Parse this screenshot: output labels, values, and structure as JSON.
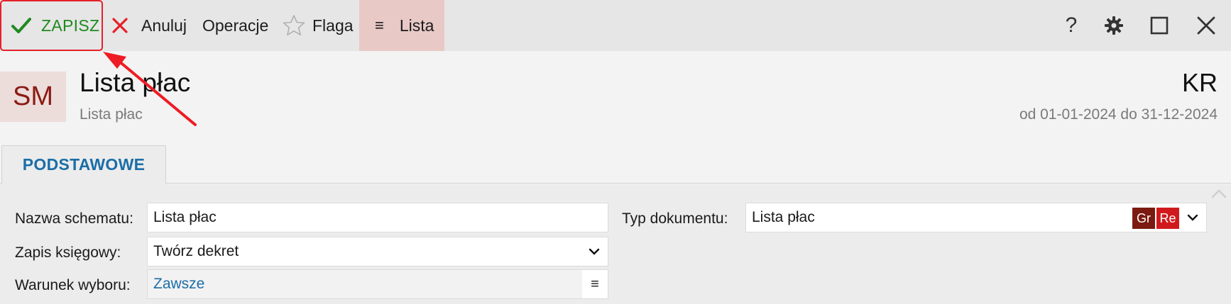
{
  "toolbar": {
    "save_label": "ZAPISZ",
    "cancel_label": "Anuluj",
    "operations_label": "Operacje",
    "flag_label": "Flaga",
    "list_label": "Lista",
    "list_glyph": "≡",
    "help_glyph": "?"
  },
  "header": {
    "avatar": "SM",
    "title": "Lista płac",
    "subtitle": "Lista płac",
    "code": "KR",
    "date_range": "od 01-01-2024 do 31-12-2024"
  },
  "tabs": [
    {
      "label": "PODSTAWOWE",
      "active": true
    }
  ],
  "form": {
    "schema_name": {
      "label": "Nazwa schematu:",
      "value": "Lista płac"
    },
    "accounting": {
      "label": "Zapis księgowy:",
      "value": "Twórz dekret"
    },
    "condition": {
      "label": "Warunek wyboru:",
      "value": "Zawsze",
      "menu_glyph": "≡"
    },
    "doc_type": {
      "label": "Typ dokumentu:",
      "value": "Lista płac",
      "badge_gr": "Gr",
      "badge_re": "Re"
    }
  },
  "colors": {
    "save_green": "#1f8a1f",
    "highlight_red": "#e5212a",
    "link_blue": "#1b6ea8",
    "list_bg": "#e8c9c6"
  }
}
